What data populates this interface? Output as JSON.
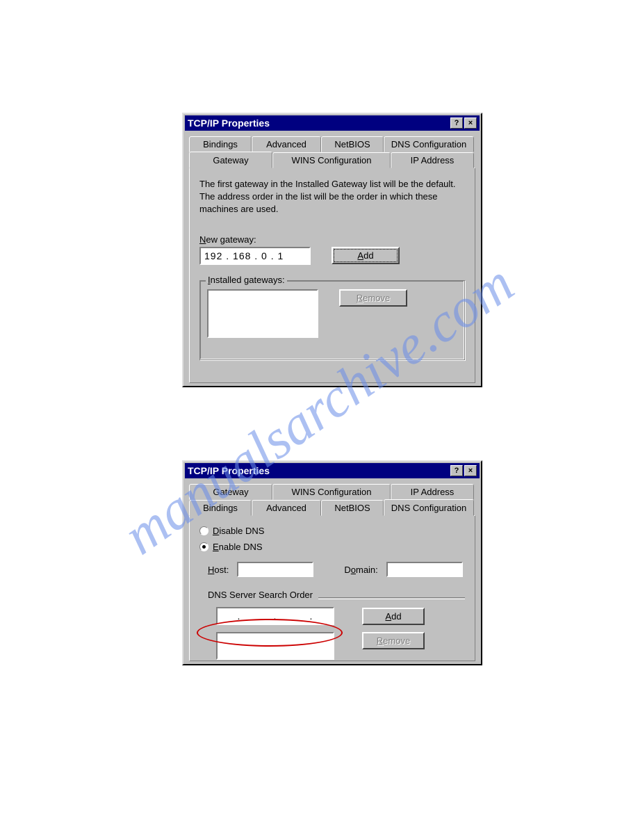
{
  "watermark": "manualsarchive.com",
  "dialog1": {
    "title": "TCP/IP Properties",
    "tabs_back": [
      "Bindings",
      "Advanced",
      "NetBIOS",
      "DNS Configuration"
    ],
    "tabs_front": [
      "Gateway",
      "WINS Configuration",
      "IP Address"
    ],
    "active_tab": "Gateway",
    "info": "The first gateway in the Installed Gateway list will be the default. The address order in the list will be the order in which these machines are used.",
    "new_gateway_label": "New gateway:",
    "new_gateway_value": "192 . 168 .   0   .   1",
    "add_label": "Add",
    "installed_label": "Installed gateways:",
    "remove_label": "Remove"
  },
  "dialog2": {
    "title": "TCP/IP Properties",
    "tabs_back": [
      "Gateway",
      "WINS Configuration",
      "IP Address"
    ],
    "tabs_front": [
      "Bindings",
      "Advanced",
      "NetBIOS",
      "DNS Configuration"
    ],
    "active_tab": "DNS Configuration",
    "disable_dns": "Disable DNS",
    "enable_dns": "Enable DNS",
    "host_label": "Host:",
    "domain_label": "Domain:",
    "search_order_label": "DNS Server Search Order",
    "dns_ip_value": ".         .         .",
    "add_label": "Add",
    "remove_label": "Remove"
  }
}
